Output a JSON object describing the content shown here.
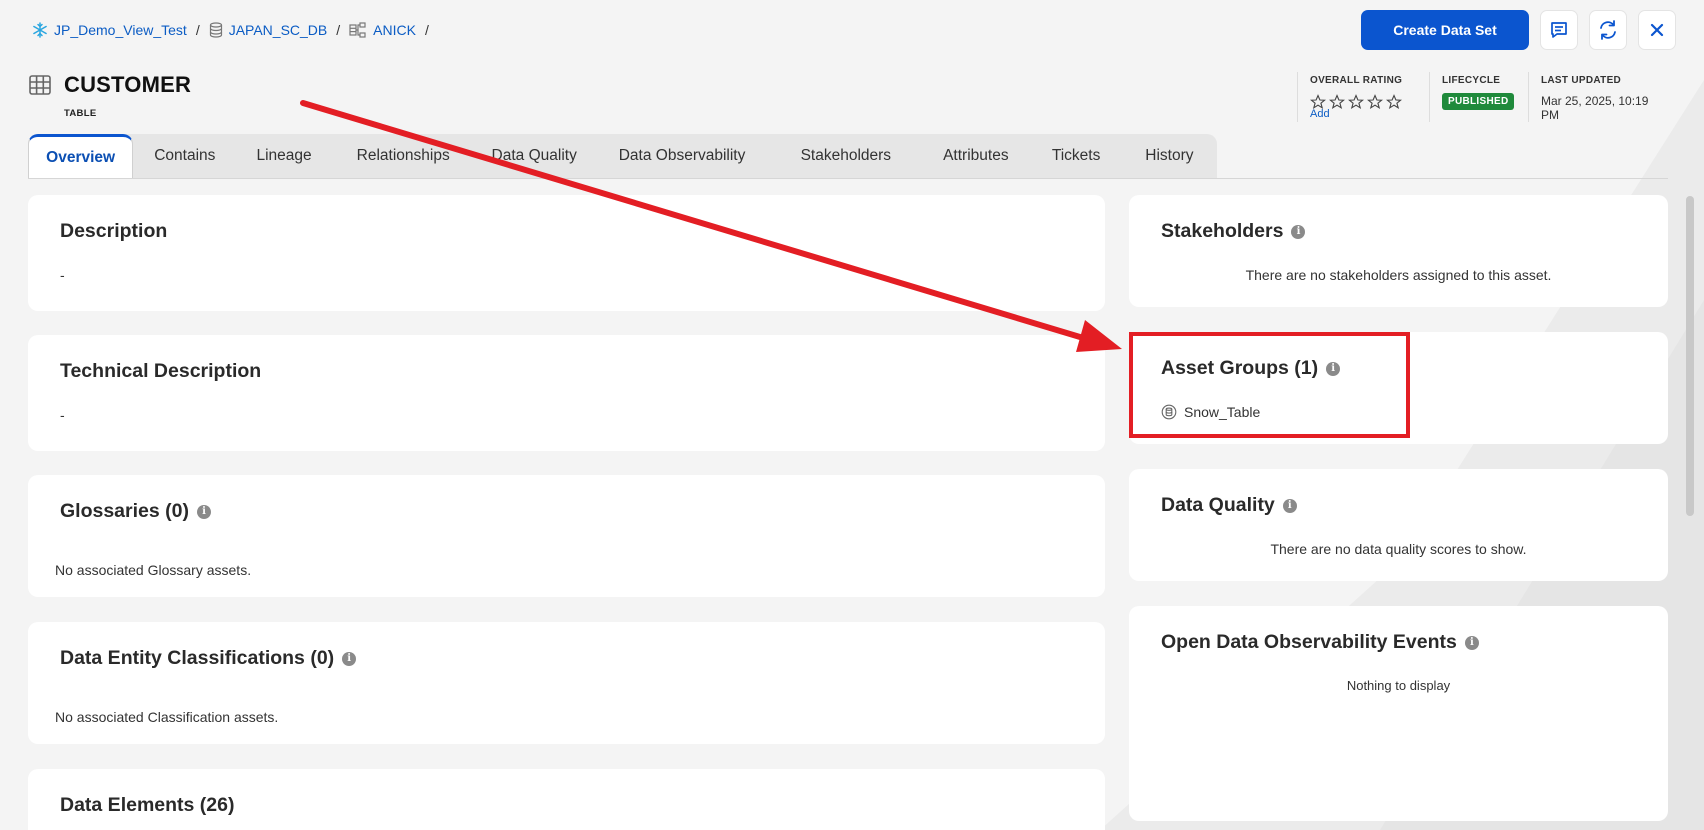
{
  "breadcrumb": {
    "items": [
      {
        "label": "JP_Demo_View_Test",
        "icon": "snowflake-icon"
      },
      {
        "label": "JAPAN_SC_DB",
        "icon": "database-icon"
      },
      {
        "label": "ANICK",
        "icon": "schema-icon"
      }
    ],
    "separator": "/"
  },
  "header": {
    "create_button": "Create Data Set",
    "icons": [
      "comment-icon",
      "refresh-icon",
      "close-icon"
    ]
  },
  "asset": {
    "title": "CUSTOMER",
    "type": "TABLE",
    "icon": "table-icon"
  },
  "meta": {
    "rating_label": "OVERALL RATING",
    "rating_stars": 0,
    "rating_max": 5,
    "add_label": "Add",
    "lifecycle_label": "LIFECYCLE",
    "lifecycle_value": "PUBLISHED",
    "updated_label": "LAST UPDATED",
    "updated_value": "Mar 25, 2025, 10:19 PM"
  },
  "tabs": [
    {
      "label": "Overview",
      "active": true
    },
    {
      "label": "Contains"
    },
    {
      "label": "Lineage"
    },
    {
      "label": "Relationships"
    },
    {
      "label": "Data Quality"
    },
    {
      "label": "Data Observability"
    },
    {
      "label": "Stakeholders"
    },
    {
      "label": "Attributes"
    },
    {
      "label": "Tickets"
    },
    {
      "label": "History"
    }
  ],
  "left": {
    "description": {
      "title": "Description",
      "value": "-"
    },
    "technical": {
      "title": "Technical Description",
      "value": "-"
    },
    "glossaries": {
      "title": "Glossaries (0)",
      "empty": "No associated Glossary assets."
    },
    "classifications": {
      "title": "Data Entity Classifications (0)",
      "empty": "No associated Classification assets."
    },
    "elements": {
      "title": "Data Elements (26)"
    }
  },
  "right": {
    "stakeholders": {
      "title": "Stakeholders",
      "empty": "There are no stakeholders assigned to this asset."
    },
    "asset_groups": {
      "title": "Asset Groups (1)",
      "items": [
        "Snow_Table"
      ]
    },
    "data_quality": {
      "title": "Data Quality",
      "empty": "There are no data quality scores to show."
    },
    "observability": {
      "title": "Open Data Observability Events",
      "empty": "Nothing to display"
    }
  },
  "colors": {
    "primary": "#0b55cf",
    "link": "#0b5cc4",
    "published": "#1f8a3b",
    "annotation": "#e31e24"
  }
}
